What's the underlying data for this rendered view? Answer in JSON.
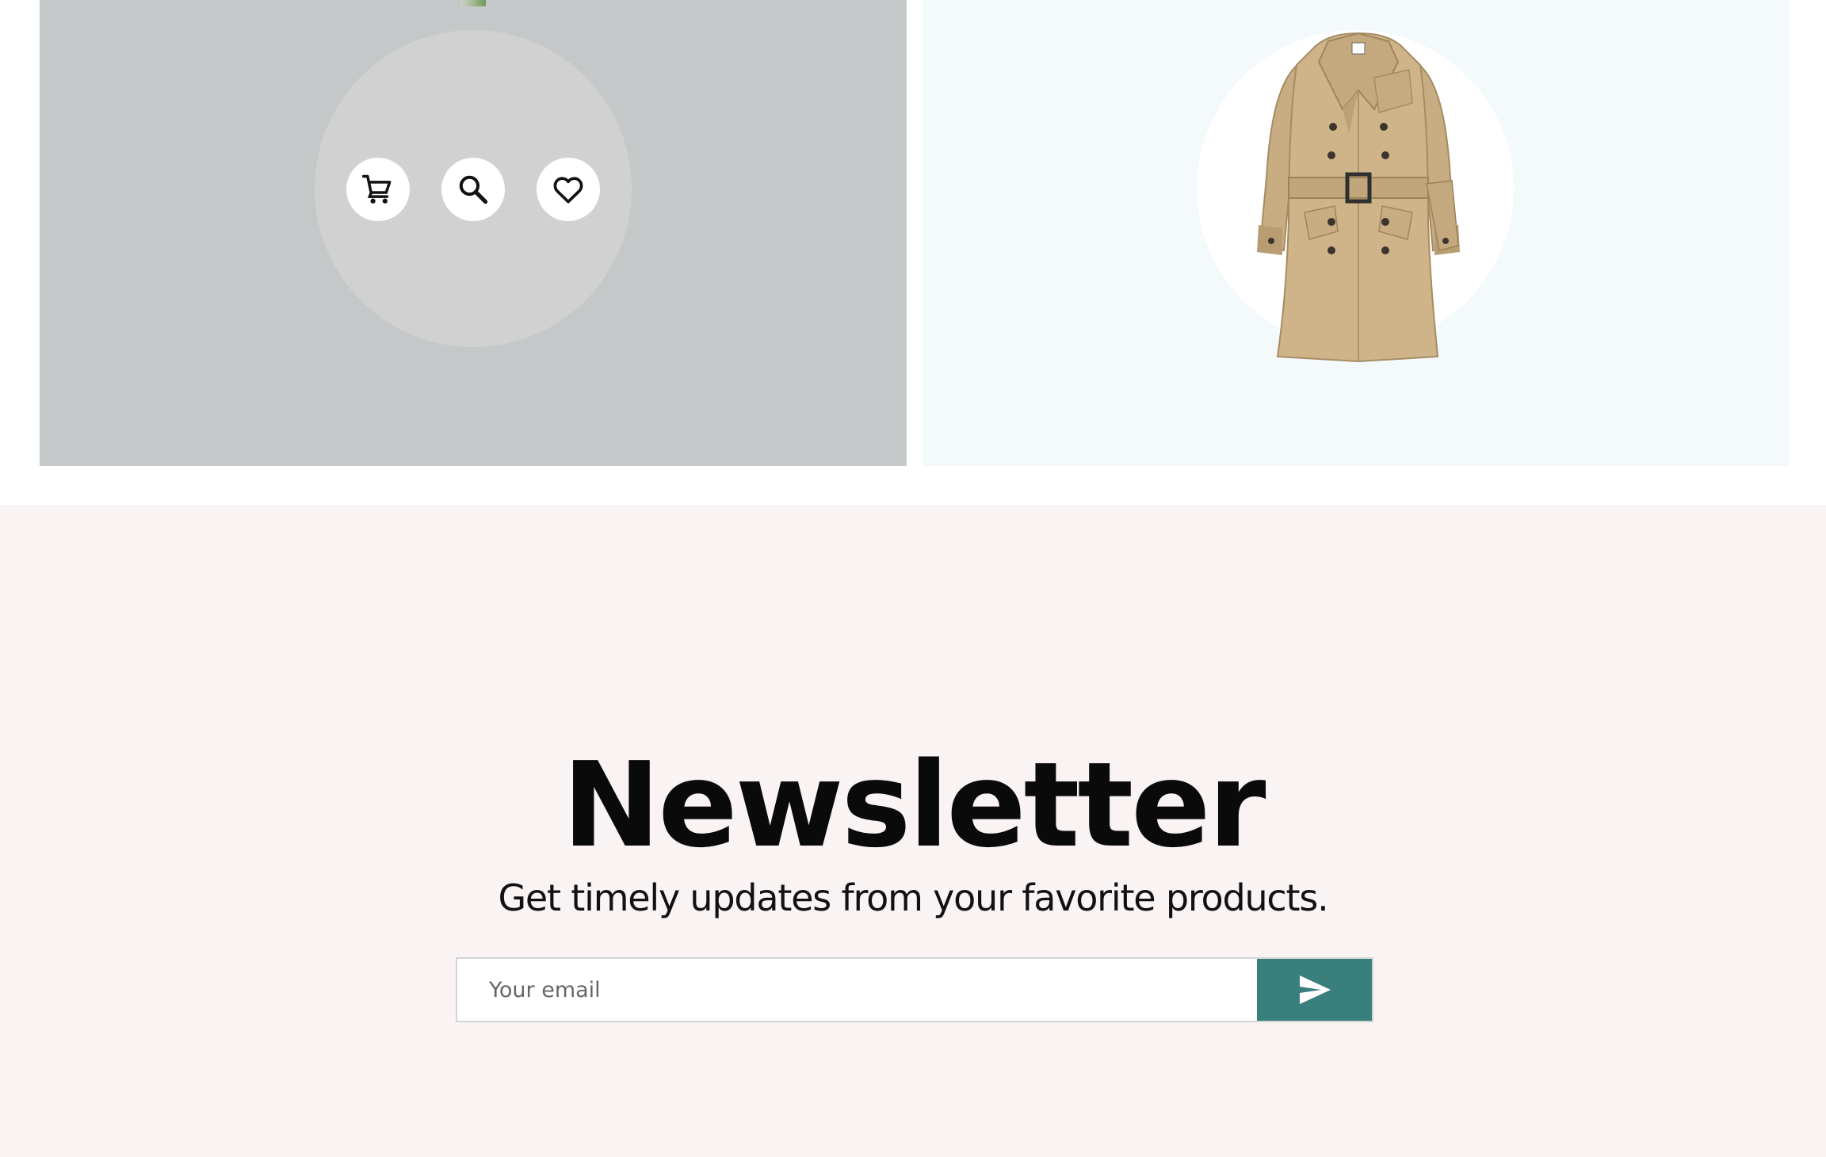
{
  "products": {
    "left_card": {
      "actions": [
        {
          "icon": "cart-icon"
        },
        {
          "icon": "search-icon"
        },
        {
          "icon": "heart-icon"
        }
      ]
    },
    "right_card": {
      "image": "trench-coat"
    }
  },
  "newsletter": {
    "title": "Newsletter",
    "subtitle": "Get timely updates from your favorite products.",
    "email_placeholder": "Your email",
    "submit_icon": "send-icon"
  },
  "colors": {
    "left_card_bg": "#c5c8c9",
    "right_card_bg": "#f4f9fc",
    "newsletter_bg": "#f9f3f3",
    "accent": "#397f7e"
  }
}
